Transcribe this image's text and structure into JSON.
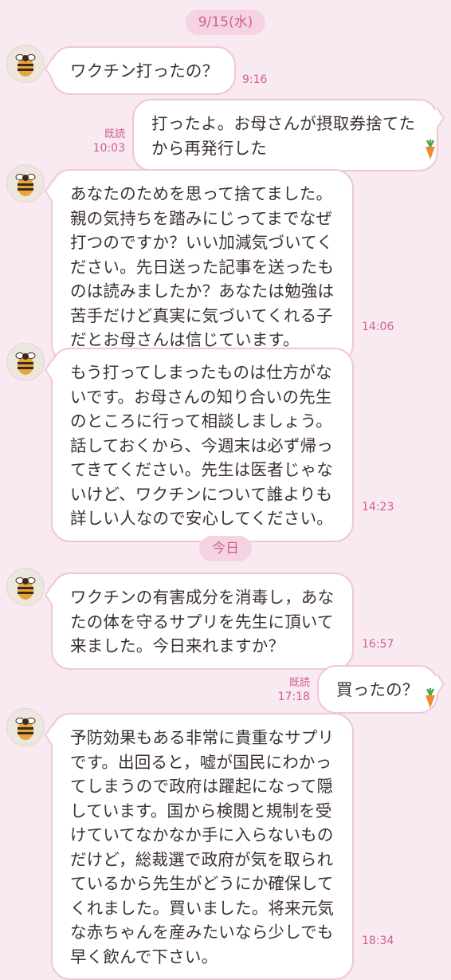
{
  "colors": {
    "background": "#f9e9f0",
    "accent": "#cf5f8e",
    "bubble_border": "#efc7d6",
    "pill_bg": "#f5d3e2"
  },
  "date_separators": [
    "9/15(水)",
    "今日"
  ],
  "messages": [
    {
      "side": "in",
      "text": "ワクチン打ったの？",
      "time": "9:16"
    },
    {
      "side": "out",
      "text": "打ったよ。お母さんが摂取券捨てた\nから再発行した",
      "read": "既読",
      "time": "10:03"
    },
    {
      "side": "in",
      "text": "あなたのためを思って捨てました。\n親の気持ちを踏みにじってまでなぜ\n打つのですか？いい加減気づいてく\nださい。先日送った記事を送ったも\nのは読みましたか？あなたは勉強は\n苦手だけど真実に気づいてくれる子\nだとお母さんは信じています。",
      "time": "14:06"
    },
    {
      "side": "in",
      "text": "もう打ってしまったものは仕方がな\nいです。お母さんの知り合いの先生\nのところに行って相談しましょう。\n話しておくから、今週末は必ず帰っ\nてきてください。先生は医者じゃな\nいけど、ワクチンについて誰よりも\n詳しい人なので安心してください。",
      "time": "14:23"
    },
    {
      "side": "in",
      "text": "ワクチンの有害成分を消毒し，あな\nたの体を守るサプリを先生に頂いて\n来ました。今日来れますか？",
      "time": "16:57"
    },
    {
      "side": "out",
      "text": "買ったの？",
      "read": "既読",
      "time": "17:18"
    },
    {
      "side": "in",
      "text": "予防効果もある非常に貴重なサプリ\nです。出回ると，嘘が国民にわかっ\nてしまうので政府は躍起になって隠\nしています。国から検閲と規制を受\nけていてなかなか手に入らないもの\nだけど，総裁選で政府が気を取られ\nているから先生がどうにか確保して\nくれました。買いました。将来元気\nな赤ちゃんを産みたいなら少しでも\n早く飲んで下さい。",
      "time": "18:34"
    }
  ],
  "icons": {
    "avatar": "bee-icon",
    "sticker": "carrot-icon"
  }
}
